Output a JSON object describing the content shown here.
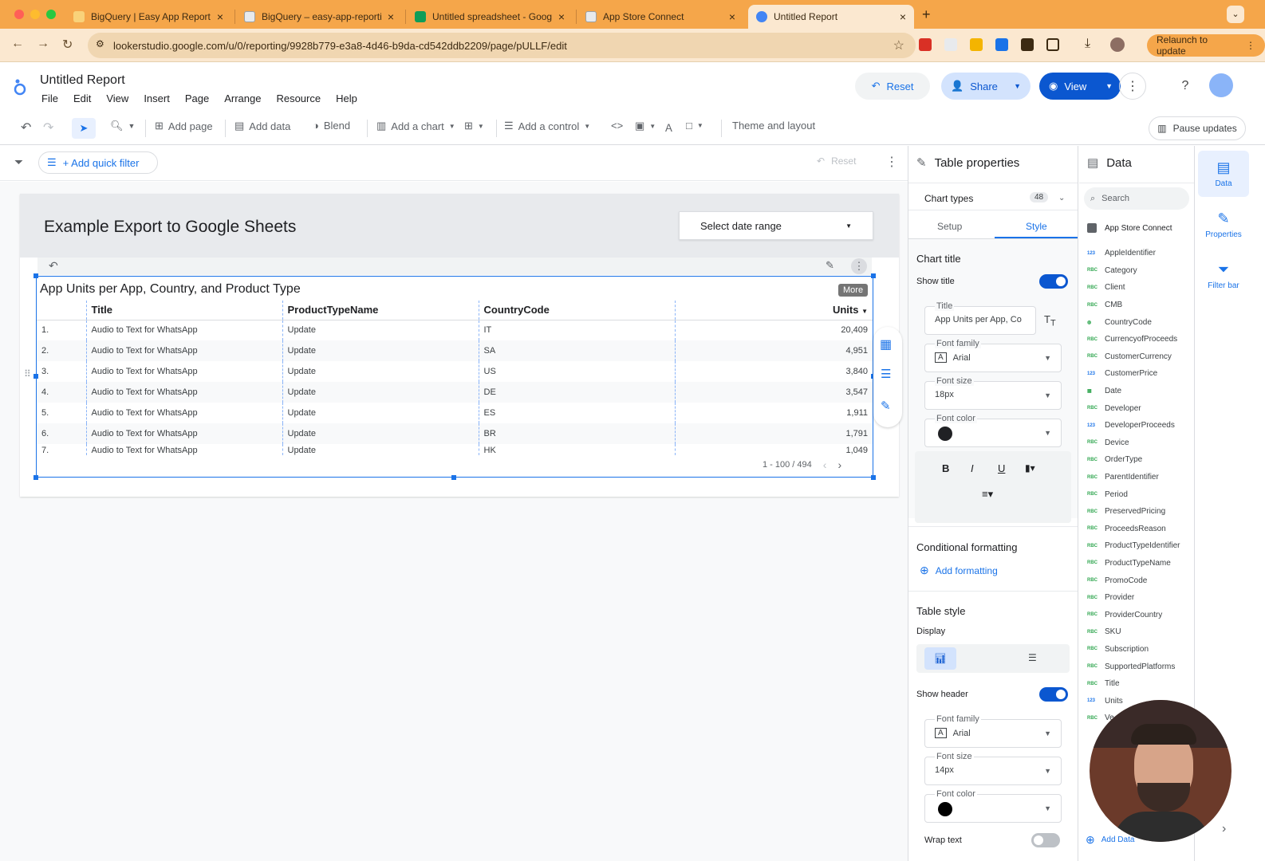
{
  "browser": {
    "tabs": [
      {
        "label": "BigQuery | Easy App Reports",
        "favicon_color": "#f9d27a"
      },
      {
        "label": "BigQuery – easy-app-reporti",
        "favicon_color": "#e8eaed"
      },
      {
        "label": "Untitled spreadsheet - Goog",
        "favicon_color": "#0f9d58"
      },
      {
        "label": "App Store Connect",
        "favicon_color": "#e8eaed"
      },
      {
        "label": "Untitled Report",
        "favicon_color": "#4285f4"
      }
    ],
    "url": "lookerstudio.google.com/u/0/reporting/9928b779-e3a8-4d46-b9da-cd542ddb2209/page/pULLF/edit",
    "relaunch_label": "Relaunch to update",
    "accent": "#f5a64a"
  },
  "app": {
    "title": "Untitled Report",
    "menu": [
      "File",
      "Edit",
      "View",
      "Insert",
      "Page",
      "Arrange",
      "Resource",
      "Help"
    ],
    "reset_label": "Reset",
    "share_label": "Share",
    "view_label": "View"
  },
  "toolbar": {
    "add_page": "Add page",
    "add_data": "Add data",
    "blend": "Blend",
    "add_chart": "Add a chart",
    "add_control": "Add a control",
    "theme": "Theme and layout",
    "pause": "Pause updates"
  },
  "filterbar": {
    "quick_filter": "+ Add quick filter",
    "reset": "Reset"
  },
  "report": {
    "page_title": "Example Export to Google Sheets",
    "date_range": "Select date range",
    "table_title": "App Units per App, Country, and Product Type",
    "more_tooltip": "More",
    "columns": [
      "Title",
      "ProductTypeName",
      "CountryCode",
      "Units"
    ],
    "rows": [
      {
        "n": "1.",
        "title": "Audio to Text for WhatsApp",
        "type": "Update",
        "country": "IT",
        "units": "20,409"
      },
      {
        "n": "2.",
        "title": "Audio to Text for WhatsApp",
        "type": "Update",
        "country": "SA",
        "units": "4,951"
      },
      {
        "n": "3.",
        "title": "Audio to Text for WhatsApp",
        "type": "Update",
        "country": "US",
        "units": "3,840"
      },
      {
        "n": "4.",
        "title": "Audio to Text for WhatsApp",
        "type": "Update",
        "country": "DE",
        "units": "3,547"
      },
      {
        "n": "5.",
        "title": "Audio to Text for WhatsApp",
        "type": "Update",
        "country": "ES",
        "units": "1,911"
      },
      {
        "n": "6.",
        "title": "Audio to Text for WhatsApp",
        "type": "Update",
        "country": "BR",
        "units": "1,791"
      },
      {
        "n": "7.",
        "title": "Audio to Text for WhatsApp",
        "type": "Update",
        "country": "HK",
        "units": "1,049"
      }
    ],
    "pagination": "1 - 100 / 494"
  },
  "properties": {
    "header": "Table properties",
    "chart_types": "Chart types",
    "chart_types_count": "48",
    "tab_setup": "Setup",
    "tab_style": "Style",
    "chart_title_section": "Chart title",
    "show_title": "Show title",
    "title_label": "Title",
    "title_value": "App Units per App, Co",
    "font_family_label": "Font family",
    "font_family_value": "Arial",
    "font_size_label": "Font size",
    "font_size_value": "18px",
    "font_color_label": "Font color",
    "conditional_formatting": "Conditional formatting",
    "add_formatting": "Add formatting",
    "table_style": "Table style",
    "display": "Display",
    "show_header": "Show header",
    "header_font_family_label": "Font family",
    "header_font_family_value": "Arial",
    "header_font_size_label": "Font size",
    "header_font_size_value": "14px",
    "header_font_color_label": "Font color",
    "wrap_text": "Wrap text"
  },
  "data_panel": {
    "header": "Data",
    "search_placeholder": "Search",
    "source": "App Store Connect",
    "fields": [
      {
        "name": "AppleIdentifier",
        "type": "123"
      },
      {
        "name": "Category",
        "type": "RBC"
      },
      {
        "name": "Client",
        "type": "RBC"
      },
      {
        "name": "CMB",
        "type": "RBC"
      },
      {
        "name": "CountryCode",
        "type": "geo"
      },
      {
        "name": "CurrencyofProceeds",
        "type": "RBC"
      },
      {
        "name": "CustomerCurrency",
        "type": "RBC"
      },
      {
        "name": "CustomerPrice",
        "type": "123"
      },
      {
        "name": "Date",
        "type": "date"
      },
      {
        "name": "Developer",
        "type": "RBC"
      },
      {
        "name": "DeveloperProceeds",
        "type": "123"
      },
      {
        "name": "Device",
        "type": "RBC"
      },
      {
        "name": "OrderType",
        "type": "RBC"
      },
      {
        "name": "ParentIdentifier",
        "type": "RBC"
      },
      {
        "name": "Period",
        "type": "RBC"
      },
      {
        "name": "PreservedPricing",
        "type": "RBC"
      },
      {
        "name": "ProceedsReason",
        "type": "RBC"
      },
      {
        "name": "ProductTypeIdentifier",
        "type": "RBC"
      },
      {
        "name": "ProductTypeName",
        "type": "RBC"
      },
      {
        "name": "PromoCode",
        "type": "RBC"
      },
      {
        "name": "Provider",
        "type": "RBC"
      },
      {
        "name": "ProviderCountry",
        "type": "RBC"
      },
      {
        "name": "SKU",
        "type": "RBC"
      },
      {
        "name": "Subscription",
        "type": "RBC"
      },
      {
        "name": "SupportedPlatforms",
        "type": "RBC"
      },
      {
        "name": "Title",
        "type": "RBC"
      },
      {
        "name": "Units",
        "type": "123"
      },
      {
        "name": "Ve",
        "type": "RBC"
      }
    ],
    "add_data": "Add Data"
  },
  "rail": {
    "data": "Data",
    "properties": "Properties",
    "filter_bar": "Filter bar"
  }
}
